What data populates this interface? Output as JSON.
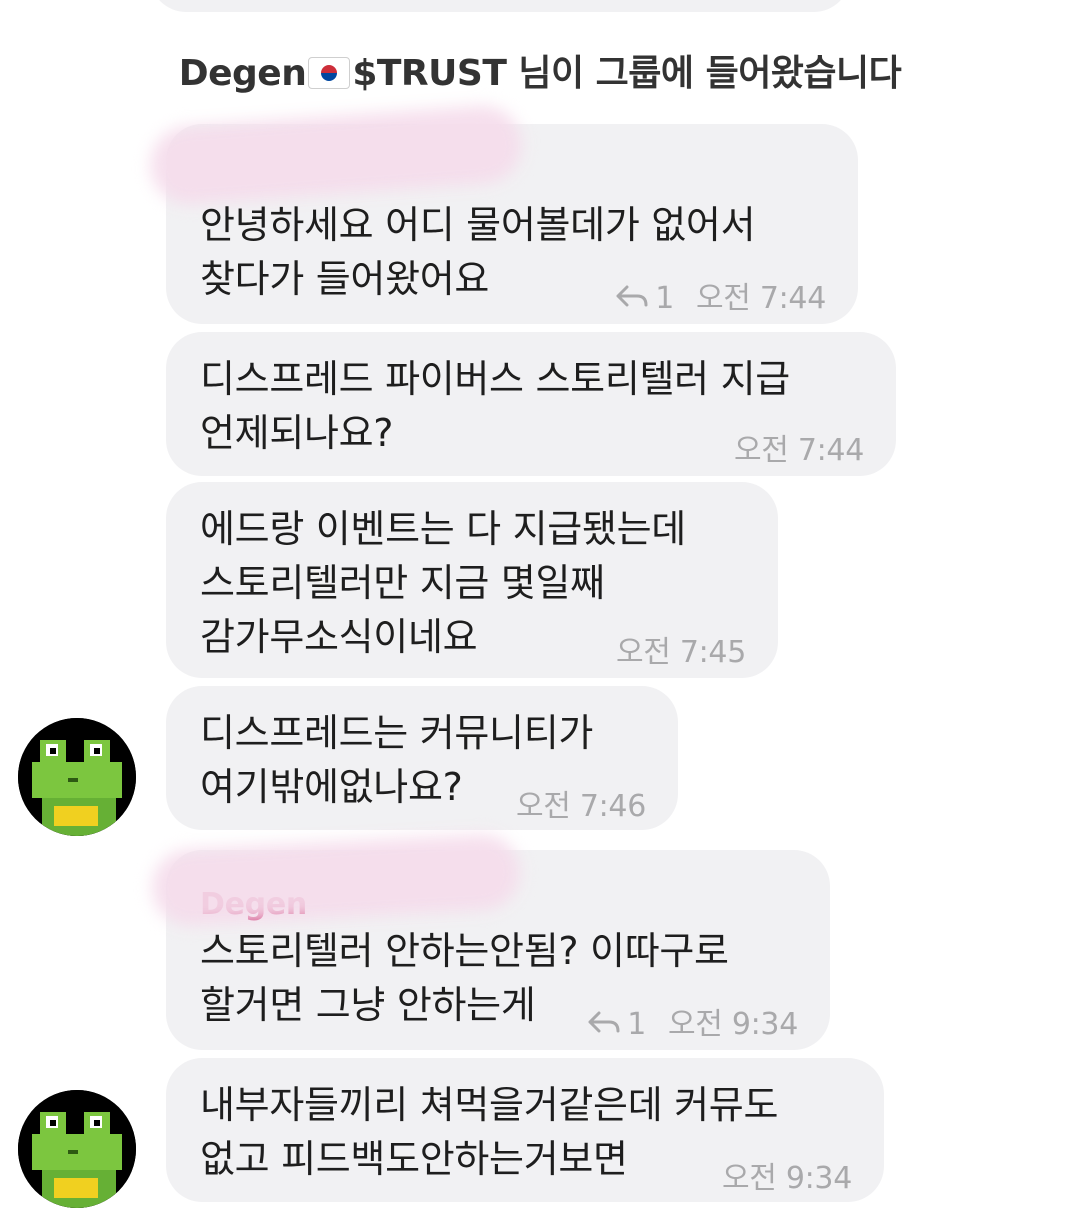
{
  "system_message": {
    "prefix": "Degen",
    "suffix": "$TRUST 님이 그룹에 들어왔습니다"
  },
  "messages": [
    {
      "lines": "안녕하세요 어디 물어볼데가 없어서\n찾다가 들어왔어요",
      "reply_count": "1",
      "time": "오전 7:44"
    },
    {
      "lines": "디스프레드 파이버스 스토리텔러 지급\n언제되나요?",
      "time": "오전 7:44"
    },
    {
      "lines": "에드랑 이벤트는 다 지급됐는데\n스토리텔러만 지금 몇일째\n감가무소식이네요",
      "time": "오전 7:45"
    },
    {
      "lines": "디스프레드는 커뮤니티가\n여기밖에없나요?",
      "time": "오전 7:46"
    },
    {
      "sender": "Degen",
      "lines": "스토리텔러 안하는안됨? 이따구로\n할거면 그냥 안하는게",
      "reply_count": "1",
      "time": "오전 9:34"
    },
    {
      "lines": "내부자들끼리 쳐먹을거같은데 커뮤도\n없고 피드백도안하는거보면",
      "time": "오전 9:34"
    }
  ],
  "colors": {
    "bubble": "#f1f1f3",
    "meta": "#a9a9ab",
    "sender": "#c2185b"
  },
  "icons": [
    "reply-icon",
    "frog-avatar",
    "korea-flag-icon"
  ]
}
